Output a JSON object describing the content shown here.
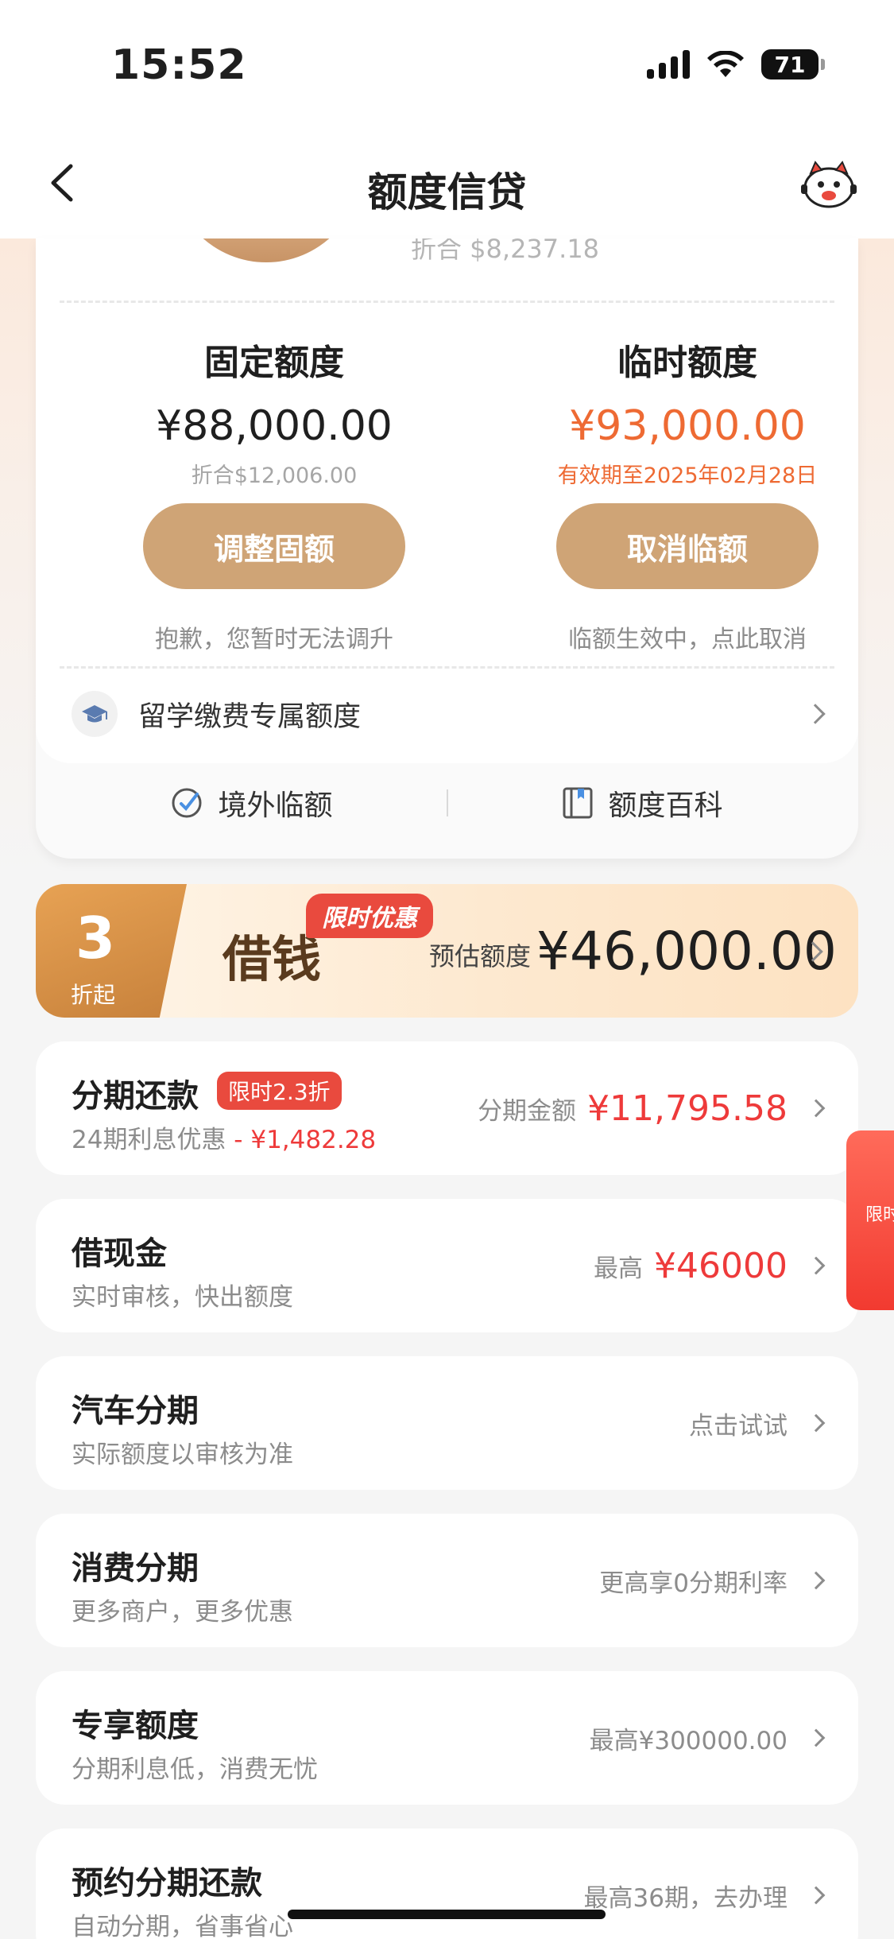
{
  "status_bar": {
    "time": "15:52",
    "battery": "71"
  },
  "nav": {
    "title": "额度信贷"
  },
  "quota": {
    "prev_conversion": "折合 $8,237.18",
    "fixed": {
      "label": "固定额度",
      "amount": "¥88,000.00",
      "conversion": "折合$12,006.00",
      "button": "调整固额",
      "note": "抱歉，您暂时无法调升"
    },
    "temporary": {
      "label": "临时额度",
      "amount": "¥93,000.00",
      "validity": "有效期至2025年02月28日",
      "button": "取消临额",
      "note": "临额生效中，点此取消"
    },
    "study_abroad": "留学缴费专属额度",
    "links": {
      "overseas": "境外临额",
      "wiki": "额度百科"
    }
  },
  "loan_banner": {
    "discount_num": "3",
    "discount_sub": "折起",
    "title": "借钱",
    "tag": "限时优惠",
    "estimate_label": "预估额度",
    "estimate_amount": "¥46,000.00"
  },
  "items": [
    {
      "title": "分期还款",
      "badge": "限时2.3折",
      "sub": "24期利息优惠",
      "sub_red": " - ¥1,482.28",
      "right_label": "分期金额",
      "right_amount": "¥11,795.58"
    },
    {
      "title": "借现金",
      "sub": "实时审核，快出额度",
      "right_label": "最高",
      "right_amount": "¥46000"
    },
    {
      "title": "汽车分期",
      "sub": "实际额度以审核为准",
      "right_text": "点击试试"
    },
    {
      "title": "消费分期",
      "sub": "更多商户，更多优惠",
      "right_text": "更高享0分期利率"
    },
    {
      "title": "专享额度",
      "sub": "分期利息低，消费无忧",
      "right_text": "最高¥300000.00"
    },
    {
      "title": "预约分期还款",
      "sub": "自动分期，省事省心",
      "right_text": "最高36期，去办理"
    }
  ],
  "float_tab": {
    "text": "限时"
  }
}
